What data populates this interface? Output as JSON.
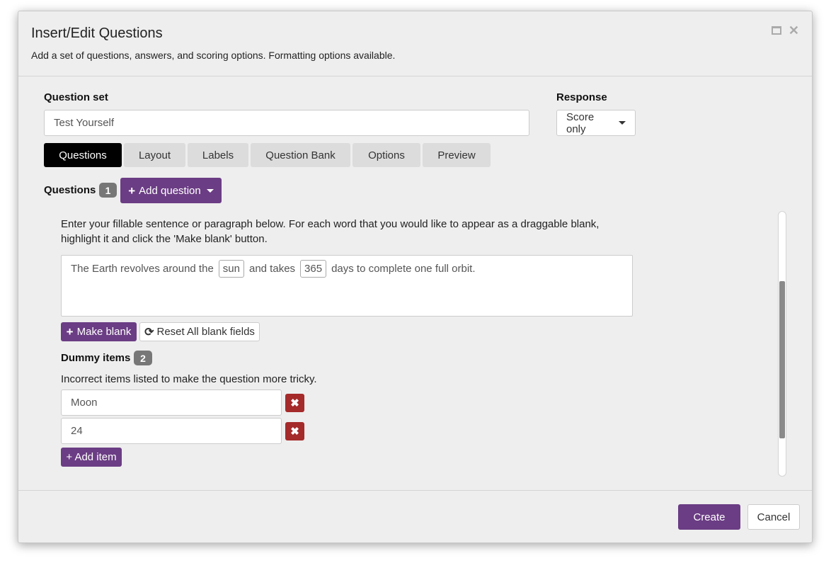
{
  "dialog": {
    "title": "Insert/Edit Questions",
    "subtitle": "Add a set of questions, answers, and scoring options. Formatting options available.",
    "maximize_icon": "maximize-icon",
    "close_icon": "close-icon"
  },
  "question_set": {
    "label": "Question set",
    "value": "Test Yourself"
  },
  "response": {
    "label": "Response",
    "selected": "Score only"
  },
  "tabs": [
    {
      "label": "Questions",
      "active": true
    },
    {
      "label": "Layout",
      "active": false
    },
    {
      "label": "Labels",
      "active": false
    },
    {
      "label": "Question Bank",
      "active": false
    },
    {
      "label": "Options",
      "active": false
    },
    {
      "label": "Preview",
      "active": false
    }
  ],
  "questions": {
    "label": "Questions",
    "count": "1",
    "add_button": "Add question"
  },
  "fillable": {
    "instructions": "Enter your fillable sentence or paragraph below. For each word that you would like to appear as a draggable blank, highlight it and click the 'Make blank' button.",
    "sentence_parts": {
      "part1": "The Earth revolves around the",
      "blank1": "sun",
      "part2": "and takes",
      "blank2": "365",
      "part3": "days to complete one full orbit."
    },
    "make_blank_button": "Make blank",
    "reset_button": "Reset All blank fields"
  },
  "dummy_items": {
    "label": "Dummy items",
    "count": "2",
    "description": "Incorrect items listed to make the question more tricky.",
    "items": [
      "Moon",
      "24"
    ],
    "add_button": "+ Add item"
  },
  "footer": {
    "create": "Create",
    "cancel": "Cancel"
  },
  "colors": {
    "accent_purple": "#6b3d84",
    "delete_red": "#a52a2a",
    "active_tab": "#000000",
    "badge_gray": "#777777"
  }
}
